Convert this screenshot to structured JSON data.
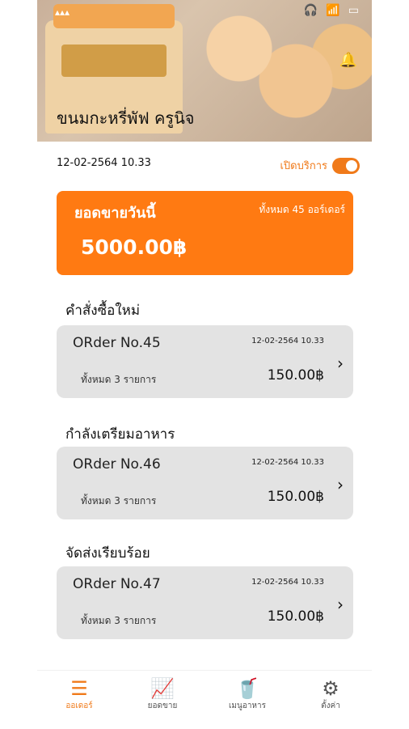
{
  "store": {
    "name": "ขนมกะหรี่พัฟ ครูนิจ"
  },
  "status_bar": {
    "signal": "▴▴▴",
    "icons": [
      "headphones-icon",
      "wifi-icon",
      "battery-icon"
    ]
  },
  "datetime": "12-02-2564   10.33",
  "service": {
    "label": "เปิดบริการ",
    "on": true
  },
  "sales": {
    "label": "ยอดขายวันนี้",
    "total_orders": "ทั้งหมด 45 ออร์เดอร์",
    "amount": "5000.00฿"
  },
  "sections": {
    "new": {
      "title": "คำสั่งซื้อใหม่",
      "order": {
        "title": "ORder No.45",
        "datetime": "12-02-2564  10.33",
        "items": "ทั้งหมด 3 รายการ",
        "price": "150.00฿"
      }
    },
    "preparing": {
      "title": "กำลังเตรียมอาหาร",
      "order": {
        "title": "ORder No.46",
        "datetime": "12-02-2564  10.33",
        "items": "ทั้งหมด 3 รายการ",
        "price": "150.00฿"
      }
    },
    "delivered": {
      "title": "จัดส่งเรียบร้อย",
      "order": {
        "title": "ORder No.47",
        "datetime": "12-02-2564  10.33",
        "items": "ทั้งหมด 3 รายการ",
        "price": "150.00฿"
      }
    }
  },
  "nav": {
    "orders": "ออเดอร์",
    "sales": "ยอดขาย",
    "menu": "เมนูอาหาร",
    "settings": "ตั้งค่า"
  },
  "colors": {
    "accent": "#ff7a12",
    "card": "#e3e3e3"
  }
}
